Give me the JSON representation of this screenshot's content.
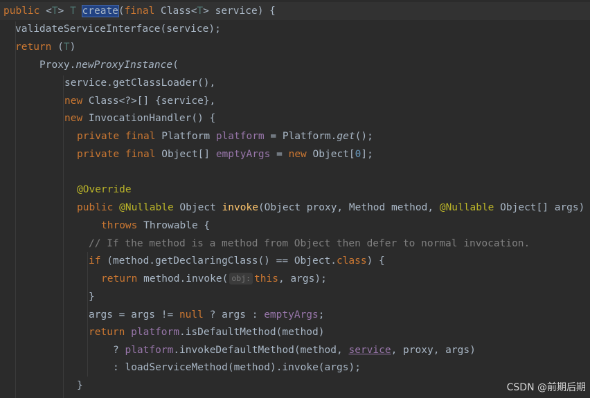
{
  "code": {
    "l1": {
      "public": "public",
      "lt": " <",
      "T1": "T",
      "gt": "> ",
      "T2": "T",
      "sp": " ",
      "create": "create",
      "paren": "(",
      "final": "final",
      "class_open": " Class<",
      "T3": "T",
      "rest": "> service) {"
    },
    "l2": {
      "text": "validateServiceInterface(service);"
    },
    "l3": {
      "return": "return",
      "open": " (",
      "T": "T",
      "close": ")"
    },
    "l4": {
      "proxy": "Proxy.",
      "method": "newProxyInstance",
      "paren": "("
    },
    "l5": {
      "text": "service.getClassLoader(),"
    },
    "l6": {
      "new": "new",
      "rest": " Class<?>[] {service},"
    },
    "l7": {
      "new": "new",
      "rest": " InvocationHandler() {"
    },
    "l8": {
      "kw": "private final",
      "type": " Platform ",
      "field": "platform",
      "eq": " = Platform.",
      "get": "get",
      "end": "();"
    },
    "l9": {
      "kw": "private final",
      "type": " Object[] ",
      "field": "emptyArgs",
      "eq": " = ",
      "new": "new",
      "obj": " Object[",
      "num": "0",
      "end": "];"
    },
    "l11": {
      "annotation": "@Override"
    },
    "l12": {
      "public": "public",
      "ann1": " @Nullable",
      "obj": " Object ",
      "invoke": "invoke",
      "params1": "(Object proxy, Method method, ",
      "ann2": "@Nullable",
      "params2": " Object[] args)"
    },
    "l13": {
      "throws": "throws",
      "rest": " Throwable {"
    },
    "l14": {
      "comment": "// If the method is a method from Object then defer to normal invocation."
    },
    "l15": {
      "if": "if",
      "mid": " (method.getDeclaringClass() == Object.",
      "class": "class",
      "end": ") {"
    },
    "l16": {
      "return": "return",
      "mid": " method.invoke(",
      "hint": "obj:",
      "this": "this",
      "end": ", args);"
    },
    "l17": {
      "text": "}"
    },
    "l18": {
      "start": "args = args != ",
      "null": "null",
      "mid": " ? args : ",
      "field": "emptyArgs",
      "end": ";"
    },
    "l19": {
      "return": "return",
      "sp": " ",
      "field": "platform",
      "rest": ".isDefaultMethod(method)"
    },
    "l20": {
      "q": "? ",
      "field": "platform",
      "mid": ".invokeDefaultMethod(method, ",
      "service": "service",
      "end": ", proxy, args)"
    },
    "l21": {
      "text": ": loadServiceMethod(method).invoke(args);"
    },
    "l22": {
      "text": "}"
    }
  },
  "watermark": "CSDN @前期后期",
  "colors": {
    "background": "#2b2b2b",
    "keyword": "#cc7832",
    "type_param": "#507874",
    "field": "#9876aa",
    "annotation": "#bbb529",
    "comment": "#808080",
    "number": "#6897bb",
    "method_decl": "#ffc66d",
    "selection": "#214283"
  }
}
